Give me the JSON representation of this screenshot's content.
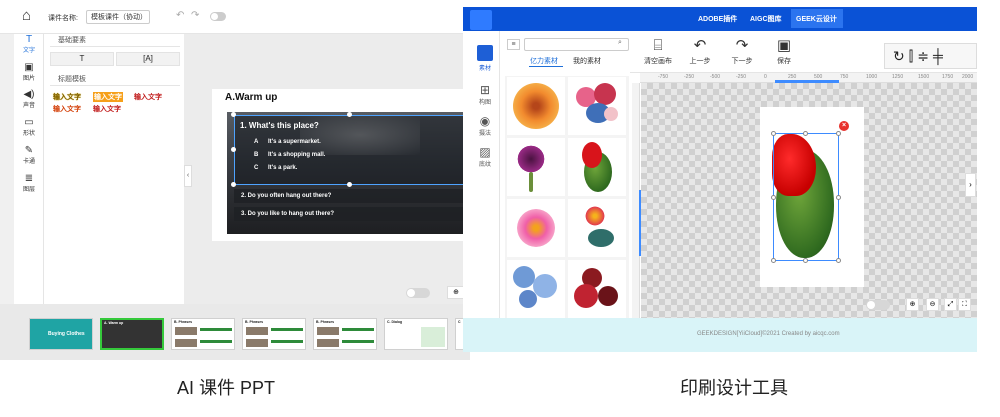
{
  "left_app": {
    "header": {
      "title_label": "课件名称:",
      "title_value": "模板课件（协动）",
      "undo_icon": "undo-icon",
      "redo_icon": "redo-icon"
    },
    "rail": [
      {
        "icon": "T",
        "label": "文字"
      },
      {
        "icon": "▣",
        "label": "图片"
      },
      {
        "icon": "◀)",
        "label": "声音"
      },
      {
        "icon": "▭",
        "label": "形状"
      },
      {
        "icon": "✎",
        "label": "卡通"
      },
      {
        "icon": "≣",
        "label": "图层"
      }
    ],
    "panel": {
      "basic_title": "基础要素",
      "basic_buttons": [
        "T",
        "[A]"
      ],
      "template_title": "标题模板",
      "templates": [
        "输入文字",
        "输入文字",
        "输入文字",
        "输入文字",
        "输入文字"
      ]
    },
    "slide": {
      "title": "A.Warm up",
      "q1": "1. What's this place?",
      "options": [
        {
          "letter": "A",
          "text": "It's a supermarket."
        },
        {
          "letter": "B",
          "text": "It's a shopping mall."
        },
        {
          "letter": "C",
          "text": "It's a park."
        }
      ],
      "q2": "2. Do you often hang out there?",
      "q3": "3. Do you like to hang out there?"
    },
    "zoom_icon": "zoom-icon",
    "thumbnails": [
      {
        "heading": "Buying Clothes",
        "kind": "cover"
      },
      {
        "heading": "A. Warm up",
        "kind": "dark"
      },
      {
        "heading": "B. Phrases",
        "kind": "list"
      },
      {
        "heading": "B. Phrases",
        "kind": "list"
      },
      {
        "heading": "B. Phrases",
        "kind": "list"
      },
      {
        "heading": "B. Phrases",
        "kind": "list"
      },
      {
        "heading": "C. Dialog",
        "kind": "dialog"
      },
      {
        "heading": "C",
        "kind": "partial"
      }
    ]
  },
  "right_app": {
    "top_tabs": [
      "ADOBE插件",
      "AIGC图库",
      "GEEK云设计"
    ],
    "rail": [
      {
        "label": "素材"
      },
      {
        "label": "构图"
      },
      {
        "label": "摄法"
      },
      {
        "label": "底纹"
      }
    ],
    "subtabs": [
      "亿力素材",
      "我的素材"
    ],
    "toolbar": [
      {
        "icon": "clear-canvas-icon",
        "label": "清空画布"
      },
      {
        "icon": "undo-icon",
        "label": "上一步"
      },
      {
        "icon": "redo-icon",
        "label": "下一步"
      },
      {
        "icon": "save-icon",
        "label": "保存"
      }
    ],
    "ruler_ticks": [
      "-750",
      "-250",
      "-500",
      "-250",
      "0",
      "250",
      "500",
      "750",
      "1000",
      "1250",
      "1500",
      "1750",
      "2000"
    ],
    "footer": "GEEKDESIGN[YiiCloud]©2021 Created by aicqc.com"
  },
  "captions": {
    "left": "AI 课件 PPT",
    "right": "印刷设计工具"
  },
  "colors": {
    "blue_header": "#0a52d6",
    "accent_blue": "#1e6fd9",
    "slide_green": "#2e8b3a",
    "delete_red": "#e8322d"
  }
}
